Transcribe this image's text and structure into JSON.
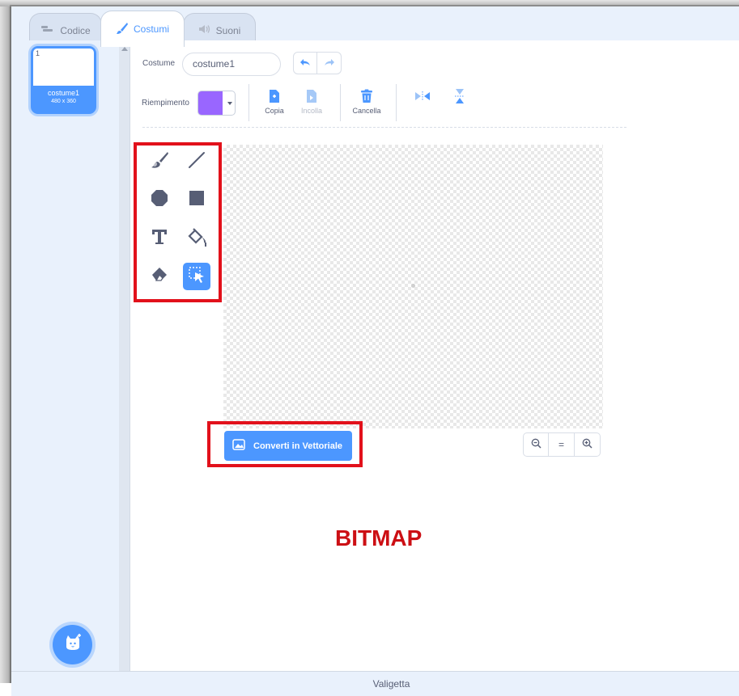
{
  "tabs": [
    {
      "label": "Codice",
      "icon": "code-icon"
    },
    {
      "label": "Costumi",
      "icon": "brush-icon",
      "active": true
    },
    {
      "label": "Suoni",
      "icon": "speaker-icon"
    }
  ],
  "costume_list": {
    "items": [
      {
        "number": "1",
        "name": "costume1",
        "size": "480 x 360"
      }
    ]
  },
  "editor": {
    "costume_label": "Costume",
    "costume_name": "costume1",
    "fill_label": "Riempimento",
    "fill_color": "#9966ff",
    "actions": {
      "copy": "Copia",
      "paste": "Incolla",
      "delete": "Cancella"
    },
    "convert_button": "Converti in Vettoriale",
    "zoom_reset": "="
  },
  "annotation": {
    "mode_label": "BITMAP",
    "highlight_color": "#e2111b"
  },
  "backpack": {
    "label": "Valigetta"
  },
  "colors": {
    "accent": "#4c97ff",
    "panel_bg": "#e9f1fc",
    "text": "#575e75"
  }
}
